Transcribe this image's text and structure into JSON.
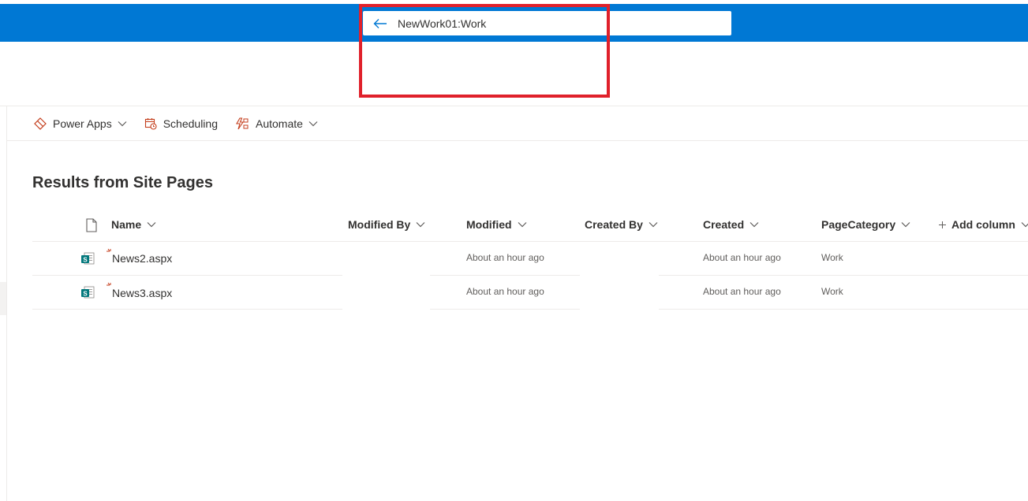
{
  "search": {
    "query": "NewWork01:Work"
  },
  "commands": [
    {
      "label": "Power Apps",
      "icon": "power-apps-icon",
      "has_dropdown": true
    },
    {
      "label": "Scheduling",
      "icon": "calendar-clock-icon",
      "has_dropdown": false
    },
    {
      "label": "Automate",
      "icon": "flow-icon",
      "has_dropdown": true
    }
  ],
  "results_title": "Results from Site Pages",
  "columns": {
    "name": "Name",
    "modified_by": "Modified By",
    "modified": "Modified",
    "created_by": "Created By",
    "created": "Created",
    "page_category": "PageCategory",
    "add_column": "Add column"
  },
  "rows": [
    {
      "name": "News2.aspx",
      "modified_by": "",
      "modified": "About an hour ago",
      "created_by": "",
      "created": "About an hour ago",
      "page_category": "Work",
      "is_new": true
    },
    {
      "name": "News3.aspx",
      "modified_by": "",
      "modified": "About an hour ago",
      "created_by": "",
      "created": "About an hour ago",
      "page_category": "Work",
      "is_new": true
    }
  ],
  "colors": {
    "brand_blue": "#0078d4",
    "highlight_red": "#e0212b",
    "accent_orange": "#c43e1c",
    "sharepoint_teal": "#03787c"
  }
}
